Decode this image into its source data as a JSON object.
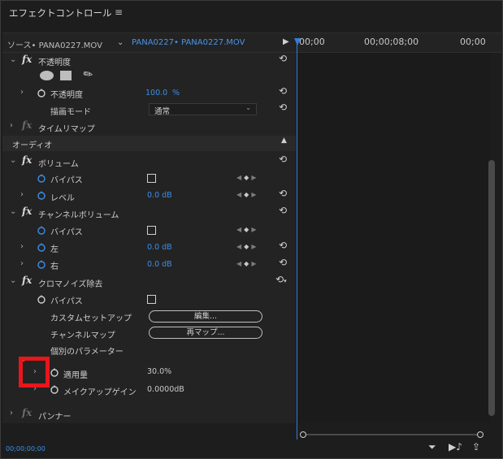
{
  "panel": {
    "title": "エフェクトコントロール",
    "menu_icon": "≡"
  },
  "tabs": {
    "source_label": "ソース• PANA0227.MOV",
    "chevron": "⌄",
    "clip_label": "PANA0227• PANA0227.MOV",
    "play": "▶"
  },
  "ruler": {
    "t0": "00;00",
    "t1": "00;00;08;00",
    "t2": "00;00"
  },
  "opacity": {
    "name": "不透明度",
    "param": "不透明度",
    "value": "100.0",
    "unit": "%",
    "blend_label": "描画モード",
    "blend_value": "通常"
  },
  "time_remap": "タイムリマップ",
  "audio_header": "オーディオ",
  "volume": {
    "name": "ボリューム",
    "bypass": "バイパス",
    "level": "レベル",
    "level_value": "0.0 dB"
  },
  "channel_volume": {
    "name": "チャンネルボリューム",
    "bypass": "バイパス",
    "left": "左",
    "left_value": "0.0 dB",
    "right": "右",
    "right_value": "0.0 dB"
  },
  "chroma": {
    "name": "クロマノイズ除去",
    "bypass": "バイパス",
    "custom_setup": "カスタムセットアップ",
    "edit_button": "編集...",
    "channel_map": "チャンネルマップ",
    "remap_button": "再マップ...",
    "params_header": "個別のパラメーター",
    "amount": "適用量",
    "amount_value": "30.0%",
    "makeup": "メイクアップゲイン",
    "makeup_value": "0.0000dB"
  },
  "panner": "パンナー",
  "timecode": "00;00;00;00",
  "colors": {
    "accent": "#2e80d8",
    "highlight": "#e8161b"
  }
}
